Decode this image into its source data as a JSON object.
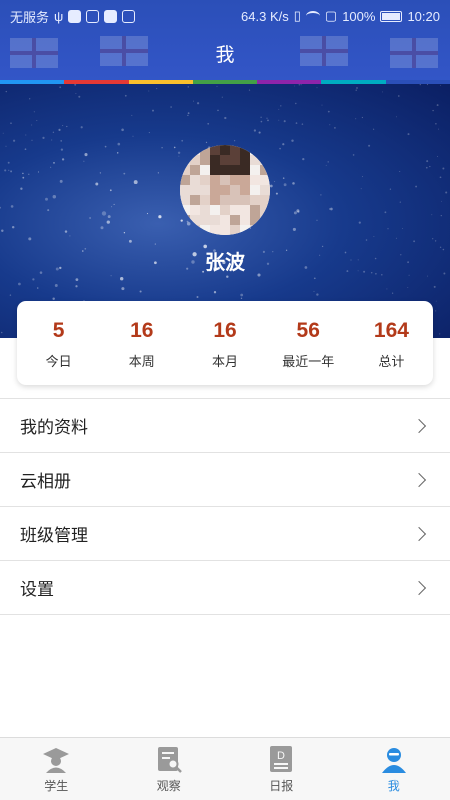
{
  "status_bar": {
    "carrier": "无服务",
    "speed": "64.3 K/s",
    "battery": "100%",
    "time": "10:20"
  },
  "header": {
    "title": "我"
  },
  "profile": {
    "name": "张波"
  },
  "stats": [
    {
      "value": "5",
      "label": "今日"
    },
    {
      "value": "16",
      "label": "本周"
    },
    {
      "value": "16",
      "label": "本月"
    },
    {
      "value": "56",
      "label": "最近一年"
    },
    {
      "value": "164",
      "label": "总计"
    }
  ],
  "menu": [
    {
      "label": "我的资料"
    },
    {
      "label": "云相册"
    },
    {
      "label": "班级管理"
    },
    {
      "label": "设置"
    }
  ],
  "tabs": [
    {
      "label": "学生",
      "icon": "graduate-icon"
    },
    {
      "label": "观察",
      "icon": "observe-icon"
    },
    {
      "label": "日报",
      "icon": "daily-report-icon"
    },
    {
      "label": "我",
      "icon": "me-icon",
      "active": true
    }
  ],
  "colors": {
    "header": "#3356c8",
    "stat_value": "#b33a1a",
    "active_tab": "#2a8ce0"
  }
}
